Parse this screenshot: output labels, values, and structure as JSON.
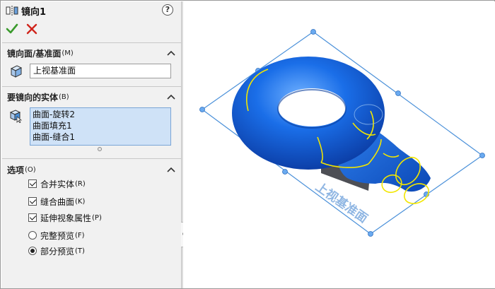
{
  "feature": {
    "title": "镜向1",
    "help_label": "?"
  },
  "sections": {
    "mirror_face": {
      "label": "镜向面/基准面",
      "hotkey": "(M)",
      "value": "上视基准面"
    },
    "bodies": {
      "label": "要镜向的实体",
      "hotkey": "(B)",
      "items": [
        "曲面-旋转2",
        "曲面填充1",
        "曲面-缝合1"
      ]
    },
    "options": {
      "label": "选项",
      "hotkey": "(O)",
      "checkboxes": [
        {
          "label": "合并实体",
          "hotkey": "(R)",
          "checked": true
        },
        {
          "label": "缝合曲面",
          "hotkey": "(K)",
          "checked": true
        },
        {
          "label": "延伸视象属性",
          "hotkey": "(P)",
          "checked": true
        }
      ],
      "radios": [
        {
          "label": "完整预览",
          "hotkey": "(F)",
          "selected": false
        },
        {
          "label": "部分预览",
          "hotkey": "(T)",
          "selected": true
        }
      ]
    }
  },
  "viewport": {
    "plane_label": "上视基准面"
  },
  "colors": {
    "accept": "#3a9a2c",
    "cancel": "#d0251c",
    "plane": "#4a90d9",
    "model": "#1f6fe0",
    "edge_highlight": "#f2e600"
  }
}
